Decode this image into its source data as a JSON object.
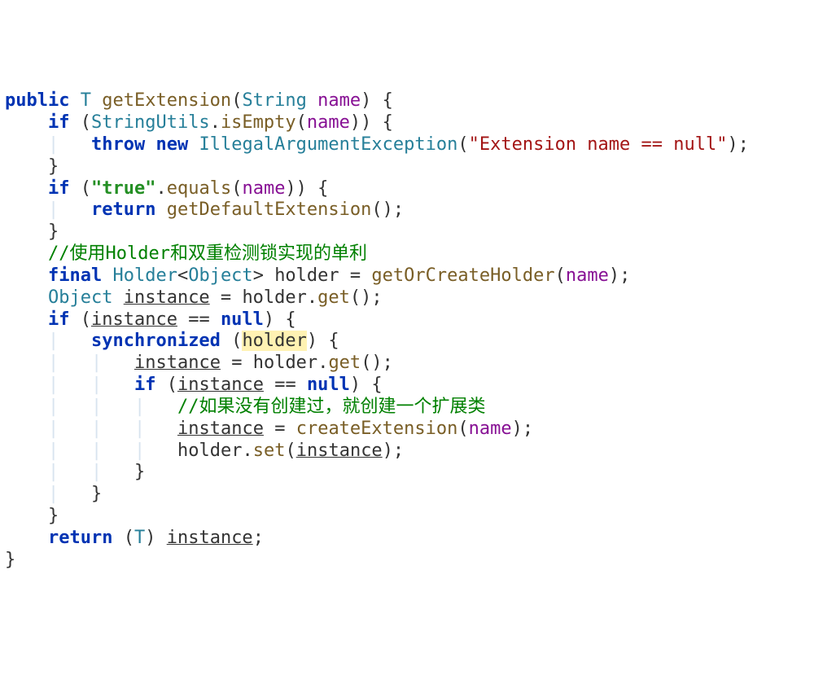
{
  "chart_data": {
    "type": "table",
    "title": "Java method getExtension(String name) — IDE syntax-highlighted source",
    "lines": [
      "public T getExtension(String name) {",
      "    if (StringUtils.isEmpty(name)) {",
      "        throw new IllegalArgumentException(\"Extension name == null\");",
      "    }",
      "    if (\"true\".equals(name)) {",
      "        return getDefaultExtension();",
      "    }",
      "    //使用Holder和双重检测锁实现的单利",
      "    final Holder<Object> holder = getOrCreateHolder(name);",
      "    Object instance = holder.get();",
      "    if (instance == null) {",
      "        synchronized (holder) {",
      "            instance = holder.get();",
      "            if (instance == null) {",
      "                //如果没有创建过，就创建一个扩展类",
      "                instance = createExtension(name);",
      "                holder.set(instance);",
      "            }",
      "        }",
      "    }",
      "    return (T) instance;",
      "}"
    ]
  },
  "tok": {
    "kw_public": "public",
    "kw_if": "if",
    "kw_throw": "throw",
    "kw_new": "new",
    "kw_return": "return",
    "kw_final": "final",
    "kw_synchronized": "synchronized",
    "kw_null": "null",
    "t_T": "T",
    "t_String": "String",
    "t_StringUtils": "StringUtils",
    "t_IllegalArgumentException": "IllegalArgumentException",
    "t_Holder": "Holder",
    "t_Object": "Object",
    "m_getExtension": "getExtension",
    "m_isEmpty": "isEmpty",
    "m_equals": "equals",
    "m_getDefaultExtension": "getDefaultExtension",
    "m_getOrCreateHolder": "getOrCreateHolder",
    "m_get": "get",
    "m_set": "set",
    "m_createExtension": "createExtension",
    "p_name": "name",
    "v_holder": "holder",
    "v_instance": "instance",
    "s_extname": "\"Extension name == null\"",
    "s_true": "\"true\"",
    "c1": "//使用Holder和双重检测锁实现的单利",
    "c2": "//如果没有创建过，就创建一个扩展类"
  }
}
